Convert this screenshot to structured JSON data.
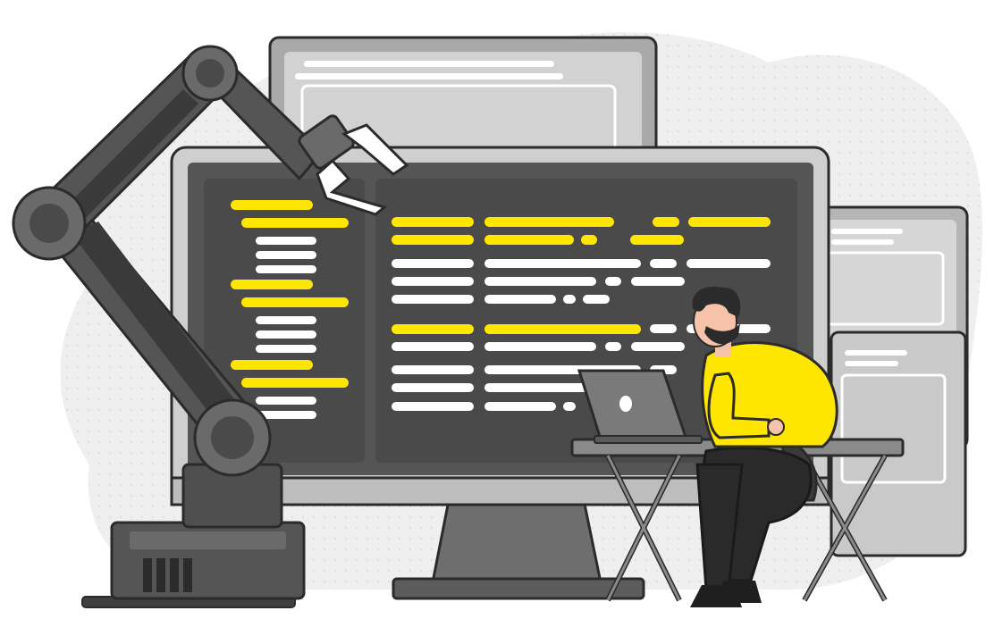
{
  "illustration": {
    "subject": "",
    "palette": {
      "background_blob": "#ededed",
      "blob_dots": "#d9d9d9",
      "dark_gray": "#555555",
      "darker_gray": "#3f3f3f",
      "mid_gray": "#808080",
      "light_gray": "#bdbdbd",
      "pale_gray": "#d9d9d9",
      "outline": "#2b2b2b",
      "code_highlight": "#ffe600",
      "code_text": "#ffffff",
      "shirt": "#ffe600",
      "skin": "#f6c3aa",
      "pants": "#2a2a2a",
      "hair": "#2b2b2b"
    },
    "icons": [
      "robot-arm-icon",
      "monitor-icon",
      "laptop-icon",
      "desk-icon",
      "developer-person-icon"
    ]
  }
}
